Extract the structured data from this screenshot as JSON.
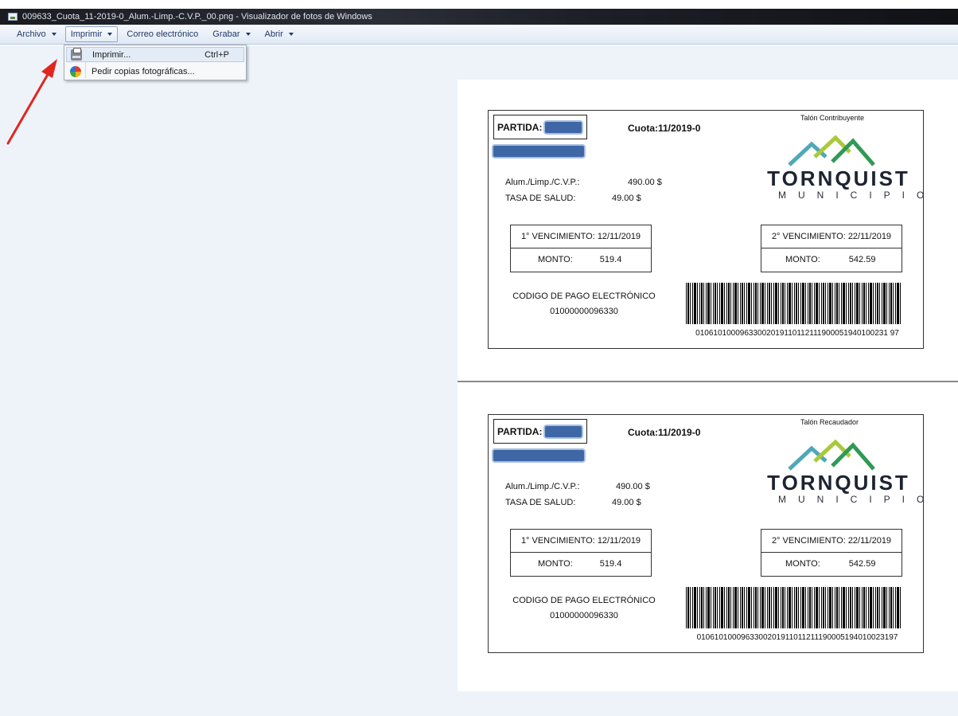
{
  "window": {
    "title": "009633_Cuota_11-2019-0_Alum.-Limp.-C.V.P._00.png - Visualizador de fotos de Windows"
  },
  "menubar": {
    "items": [
      {
        "label": "Archivo"
      },
      {
        "label": "Imprimir"
      },
      {
        "label": "Correo electrónico"
      },
      {
        "label": "Grabar"
      },
      {
        "label": "Abrir"
      }
    ]
  },
  "dropdown": {
    "items": [
      {
        "label": "Imprimir...",
        "shortcut": "Ctrl+P",
        "icon": "printer-icon"
      },
      {
        "label": "Pedir copias fotográficas...",
        "icon": "photo-order-icon"
      }
    ]
  },
  "annotation": {
    "arrow_color": "#e0261f"
  },
  "coupons": [
    {
      "talon": "Talón Contribuyente",
      "partida_label": "PARTIDA:",
      "cuota": "Cuota:11/2019-0",
      "logo": {
        "name": "TORNQUIST",
        "sub": "MUNICIPIO"
      },
      "fees": [
        {
          "label": "Alum./Limp./C.V.P.:",
          "amount": "490.00 $"
        },
        {
          "label": "TASA DE SALUD:",
          "amount": "49.00 $"
        }
      ],
      "venc1": {
        "label": "1° VENCIMIENTO: 12/11/2019",
        "monto_label": "MONTO:",
        "monto": "519.4"
      },
      "venc2": {
        "label": "2° VENCIMIENTO:  22/11/2019",
        "monto_label": "MONTO:",
        "monto": "542.59"
      },
      "codigo_label": "CODIGO DE PAGO ELECTRÓNICO",
      "codigo": "01000000096330",
      "barcode_number": "01061010009633002019110112111900051940100231 97"
    },
    {
      "talon": "Talón Recaudador",
      "partida_label": "PARTIDA:",
      "cuota": "Cuota:11/2019-0",
      "logo": {
        "name": "TORNQUIST",
        "sub": "MUNICIPIO"
      },
      "fees": [
        {
          "label": "Alum./Limp./C.V.P.:",
          "amount": "490.00 $"
        },
        {
          "label": "TASA DE SALUD:",
          "amount": "49.00 $"
        }
      ],
      "venc1": {
        "label": "1° VENCIMIENTO: 12/11/2019",
        "monto_label": "MONTO:",
        "monto": "519.4"
      },
      "venc2": {
        "label": "2° VENCIMIENTO:  22/11/2019",
        "monto_label": "MONTO:",
        "monto": "542.59"
      },
      "codigo_label": "CODIGO DE PAGO ELECTRÓNICO",
      "codigo": "01000000096330",
      "barcode_number": "0106101000963300201911011211190005194010023197"
    }
  ]
}
